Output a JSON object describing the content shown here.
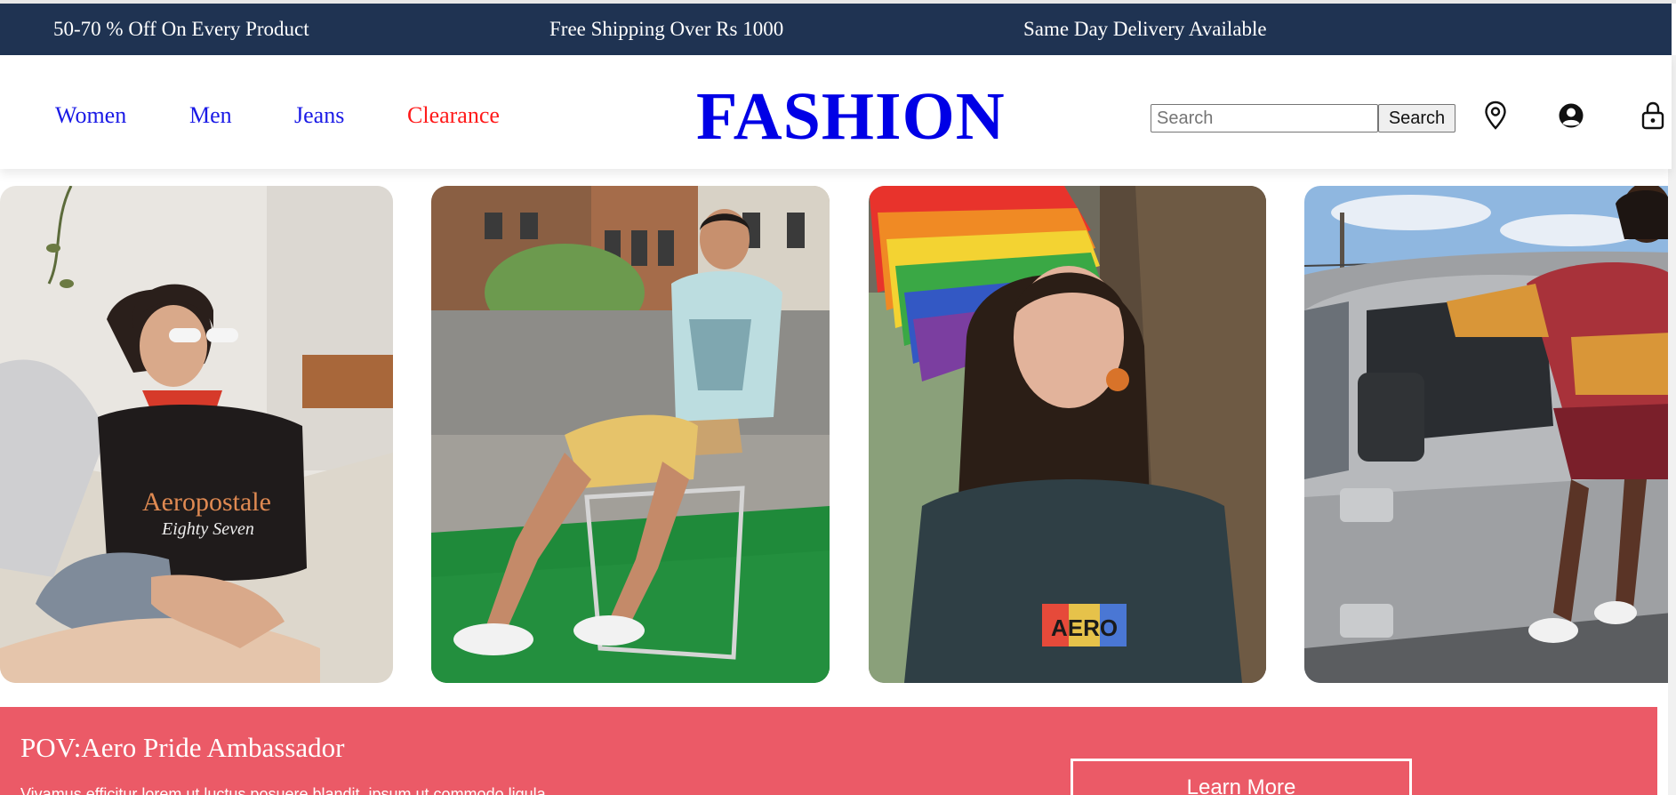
{
  "promo": {
    "items": [
      "50-70 % Off On Every Product",
      "Free Shipping Over Rs 1000",
      "Same Day Delivery Available"
    ]
  },
  "header": {
    "nav": [
      {
        "label": "Women",
        "color": "#1a1ae6"
      },
      {
        "label": "Men",
        "color": "#1a1ae6"
      },
      {
        "label": "Jeans",
        "color": "#1a1ae6"
      },
      {
        "label": "Clearance",
        "color": "#ff1a1a"
      }
    ],
    "logo": "FASHION",
    "search": {
      "placeholder": "Search",
      "value": "",
      "button_label": "Search"
    },
    "icons": [
      "location-icon",
      "account-icon",
      "cart-lock-icon"
    ]
  },
  "gallery": {
    "photos": [
      {
        "subject": "woman-in-aeropostale-tee",
        "shirt_text_1": "Aeropostale",
        "shirt_text_2": "Eighty Seven"
      },
      {
        "subject": "man-on-lawn-chair"
      },
      {
        "subject": "woman-with-pride-flag",
        "shirt_text_1": "AERO"
      },
      {
        "subject": "woman-by-jeep"
      }
    ]
  },
  "banner": {
    "title": "POV:Aero Pride Ambassador",
    "description": "Vivamus efficitur lorem ut luctus posuere blandit, ipsum ut commodo ligula",
    "button_label": "Learn More",
    "background": "#eb5a67"
  },
  "colors": {
    "promo_bg": "#1f3352",
    "nav_link": "#1a1ae6",
    "clearance": "#ff1a1a",
    "logo": "#0000e6"
  }
}
